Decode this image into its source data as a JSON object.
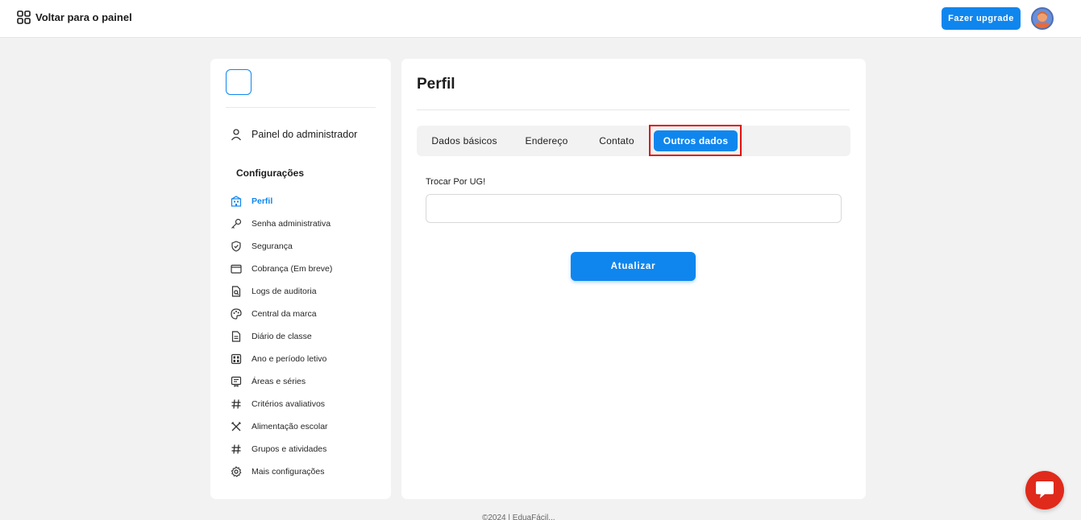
{
  "topbar": {
    "back_label": "Voltar para o painel",
    "upgrade_label": "Fazer upgrade"
  },
  "sidebar": {
    "admin_label": "Painel do administrador",
    "section_title": "Configurações",
    "items": [
      {
        "label": "Perfil",
        "icon": "building-icon",
        "active": true
      },
      {
        "label": "Senha administrativa",
        "icon": "key-icon"
      },
      {
        "label": "Segurança",
        "icon": "shield-icon"
      },
      {
        "label": "Cobrança (Em breve)",
        "icon": "wallet-icon"
      },
      {
        "label": "Logs de auditoria",
        "icon": "file-search-icon"
      },
      {
        "label": "Central da marca",
        "icon": "palette-icon"
      },
      {
        "label": "Diário de classe",
        "icon": "document-icon"
      },
      {
        "label": "Ano e período letivo",
        "icon": "calendar-icon"
      },
      {
        "label": "Áreas e séries",
        "icon": "list-icon"
      },
      {
        "label": "Critérios avaliativos",
        "icon": "hash-icon"
      },
      {
        "label": "Alimentação escolar",
        "icon": "utensils-icon"
      },
      {
        "label": "Grupos e atividades",
        "icon": "hash-icon"
      },
      {
        "label": "Mais configurações",
        "icon": "gear-icon"
      }
    ]
  },
  "main": {
    "title": "Perfil",
    "tabs": [
      {
        "label": "Dados básicos"
      },
      {
        "label": "Endereço"
      },
      {
        "label": "Contato"
      },
      {
        "label": "Outros dados",
        "active": true
      }
    ],
    "field_label": "Trocar Por UG!",
    "field_value": "",
    "submit_label": "Atualizar"
  },
  "footer": {
    "text": "©2024 | EduaFácil..."
  },
  "colors": {
    "accent": "#0f86ee",
    "highlight": "#e01010",
    "chat": "#e02a1b"
  }
}
